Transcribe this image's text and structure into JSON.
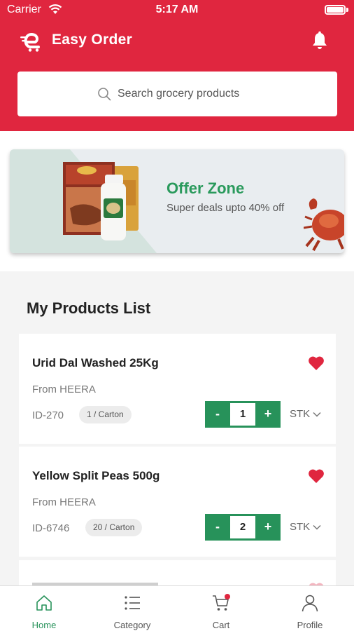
{
  "status_bar": {
    "carrier": "Carrier",
    "time": "5:17 AM"
  },
  "header": {
    "app_title": "Easy Order",
    "logo_icon": "easy-order-logo-icon",
    "notification_icon": "bell-icon"
  },
  "search": {
    "placeholder": "Search grocery products",
    "icon": "search-icon"
  },
  "banner": {
    "title": "Offer Zone",
    "subtitle": "Super deals upto 40% off",
    "title_color": "#2a9a5c"
  },
  "list": {
    "title": "My Products List",
    "products": [
      {
        "name": "Urid Dal Washed 25Kg",
        "from": "From HEERA",
        "id": "ID-270",
        "pack": "1 / Carton",
        "qty": "1",
        "unit": "STK",
        "favorite": true
      },
      {
        "name": "Yellow Split Peas 500g",
        "from": "From HEERA",
        "id": "ID-6746",
        "pack": "20 / Carton",
        "qty": "2",
        "unit": "STK",
        "favorite": true
      }
    ],
    "stepper": {
      "minus": "-",
      "plus": "+"
    }
  },
  "tabs": [
    {
      "label": "Home",
      "icon": "home-icon",
      "active": true
    },
    {
      "label": "Category",
      "icon": "list-icon",
      "active": false
    },
    {
      "label": "Cart",
      "icon": "cart-icon",
      "active": false
    },
    {
      "label": "Profile",
      "icon": "user-icon",
      "active": false
    }
  ],
  "colors": {
    "brand_red": "#e0263f",
    "accent_green": "#27925a",
    "heart_red": "#e0263f"
  }
}
